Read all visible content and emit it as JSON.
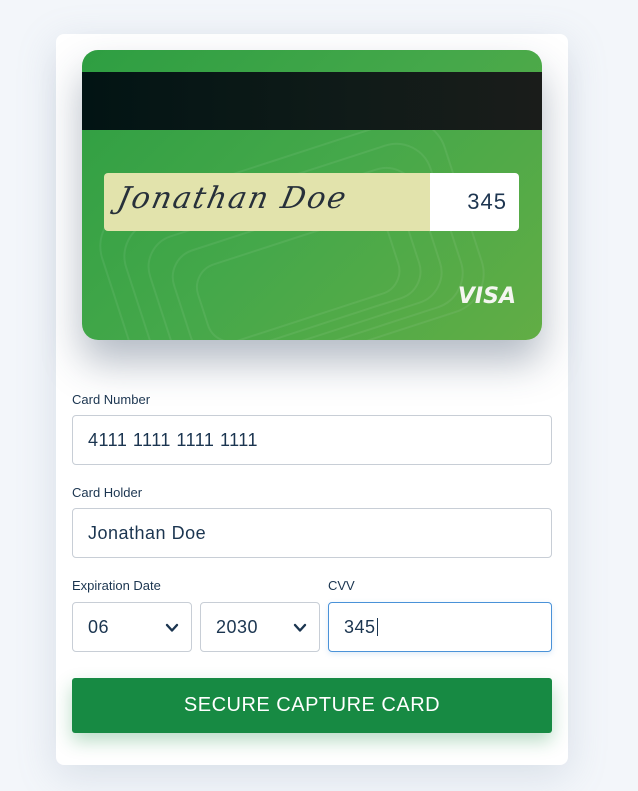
{
  "card": {
    "signature": "Jonathan Doe",
    "cvv": "345",
    "brand": "VISA"
  },
  "form": {
    "card_number": {
      "label": "Card Number",
      "value": "4111 1111 1111 1111"
    },
    "card_holder": {
      "label": "Card Holder",
      "value": "Jonathan Doe"
    },
    "expiration": {
      "label": "Expiration Date",
      "month": "06",
      "year": "2030"
    },
    "cvv": {
      "label": "CVV",
      "value": "345"
    },
    "submit_label": "SECURE CAPTURE CARD"
  },
  "colors": {
    "card_green": "#45a84a",
    "button_green": "#178a43",
    "signature_strip": "#e2e3ac",
    "focus_border": "#4a92d8"
  }
}
